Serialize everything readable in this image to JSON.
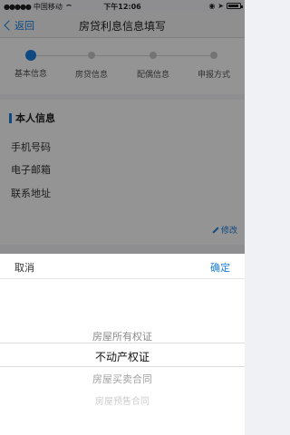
{
  "status": {
    "carrier": "中国移动",
    "time": "下午12:06"
  },
  "nav": {
    "back_label": "返回",
    "title": "房贷利息信息填写"
  },
  "steps": [
    {
      "label": "基本信息",
      "active": true
    },
    {
      "label": "房贷信息",
      "active": false
    },
    {
      "label": "配偶信息",
      "active": false
    },
    {
      "label": "申报方式",
      "active": false
    }
  ],
  "personal": {
    "section_title": "本人信息",
    "phone_label": "手机号码",
    "phone_value": "",
    "email_label": "电子邮箱",
    "email_value": "",
    "address_label": "联系地址",
    "address_value": "",
    "edit_label": "修改"
  },
  "picker": {
    "cancel_label": "取消",
    "confirm_label": "确定",
    "options": [
      "房屋所有权证",
      "不动产权证",
      "房屋买卖合同",
      "房屋预售合同"
    ],
    "selected_index": 1
  },
  "colors": {
    "accent": "#1a7ee0",
    "overlay": "rgba(0,0,0,0.42)"
  }
}
